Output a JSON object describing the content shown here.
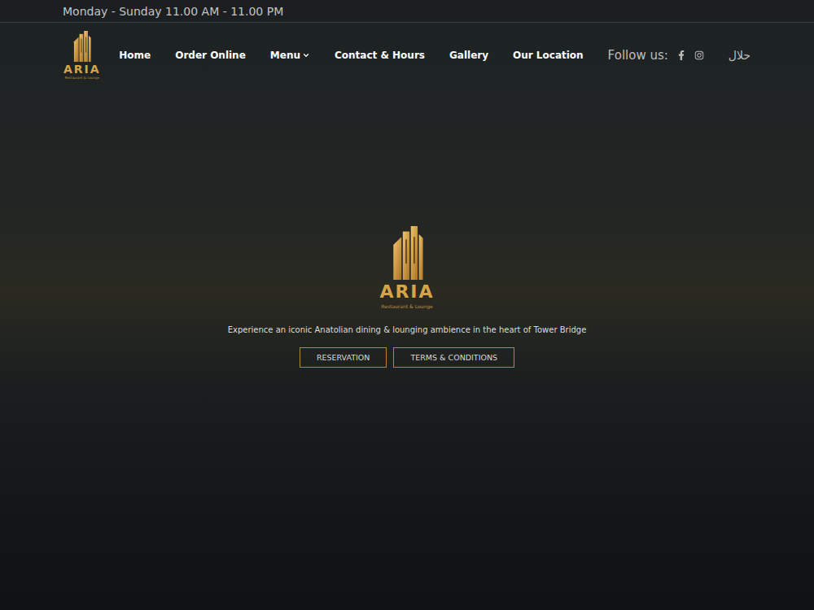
{
  "top_bar": {
    "hours": "Monday - Sunday 11.00 AM - 11.00 PM"
  },
  "logo": {
    "name": "ARIA",
    "tagline": "Restaurant & Lounge"
  },
  "nav": {
    "items": [
      {
        "label": "Home",
        "dropdown": false
      },
      {
        "label": "Order Online",
        "dropdown": false
      },
      {
        "label": "Menu",
        "dropdown": true
      },
      {
        "label": "Contact & Hours",
        "dropdown": false
      },
      {
        "label": "Gallery",
        "dropdown": false
      },
      {
        "label": "Our Location",
        "dropdown": false
      }
    ],
    "follow_label": "Follow us:",
    "halal": "حلال"
  },
  "hero": {
    "tagline": "Experience an iconic Anatolian dining & lounging ambience in the heart of Tower Bridge",
    "buttons": [
      "RESERVATION",
      "TERMS & CONDITIONS"
    ]
  }
}
